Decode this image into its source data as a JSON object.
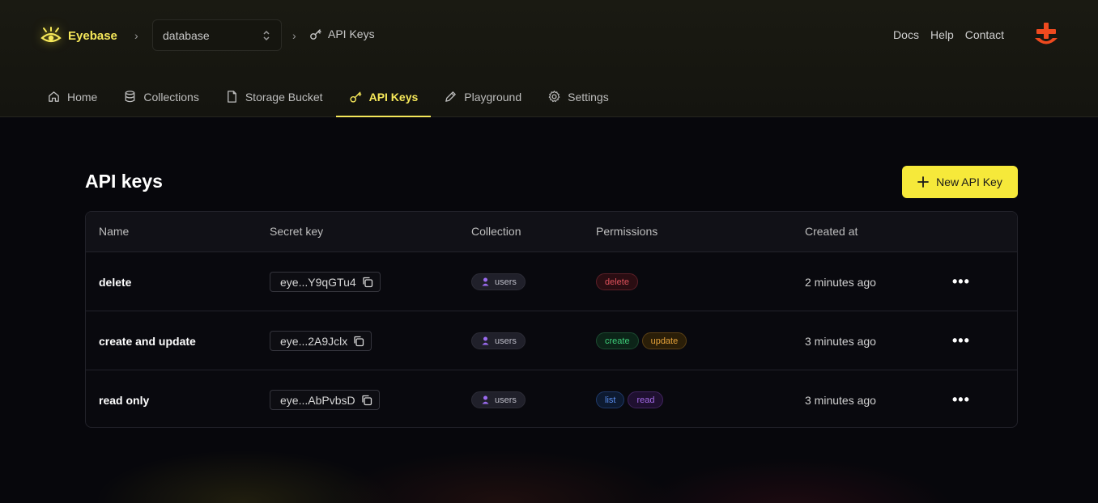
{
  "header": {
    "brand": "Eyebase",
    "database_select": "database",
    "current_crumb": "API Keys",
    "links": [
      "Docs",
      "Help",
      "Contact"
    ]
  },
  "tabs": [
    {
      "label": "Home",
      "icon": "home-icon"
    },
    {
      "label": "Collections",
      "icon": "database-icon"
    },
    {
      "label": "Storage Bucket",
      "icon": "file-icon"
    },
    {
      "label": "API Keys",
      "icon": "key-icon",
      "active": true
    },
    {
      "label": "Playground",
      "icon": "pencil-icon"
    },
    {
      "label": "Settings",
      "icon": "gear-icon"
    }
  ],
  "main": {
    "title": "API keys",
    "new_button": "New API Key",
    "columns": [
      "Name",
      "Secret key",
      "Collection",
      "Permissions",
      "Created at"
    ],
    "rows": [
      {
        "name": "delete",
        "secret": "eye...Y9qGTu4",
        "collection": "users",
        "permissions": [
          "delete"
        ],
        "created": "2 minutes ago"
      },
      {
        "name": "create and update",
        "secret": "eye...2A9Jclx",
        "collection": "users",
        "permissions": [
          "create",
          "update"
        ],
        "created": "3 minutes ago"
      },
      {
        "name": "read only",
        "secret": "eye...AbPvbsD",
        "collection": "users",
        "permissions": [
          "list",
          "read"
        ],
        "created": "3 minutes ago"
      }
    ]
  },
  "colors": {
    "accent": "#f6e93a",
    "background": "#07070c",
    "delete": "#e0525c",
    "create": "#3ecf7a",
    "update": "#e6a23a",
    "list": "#5a8ef0",
    "read": "#a46ae8"
  }
}
